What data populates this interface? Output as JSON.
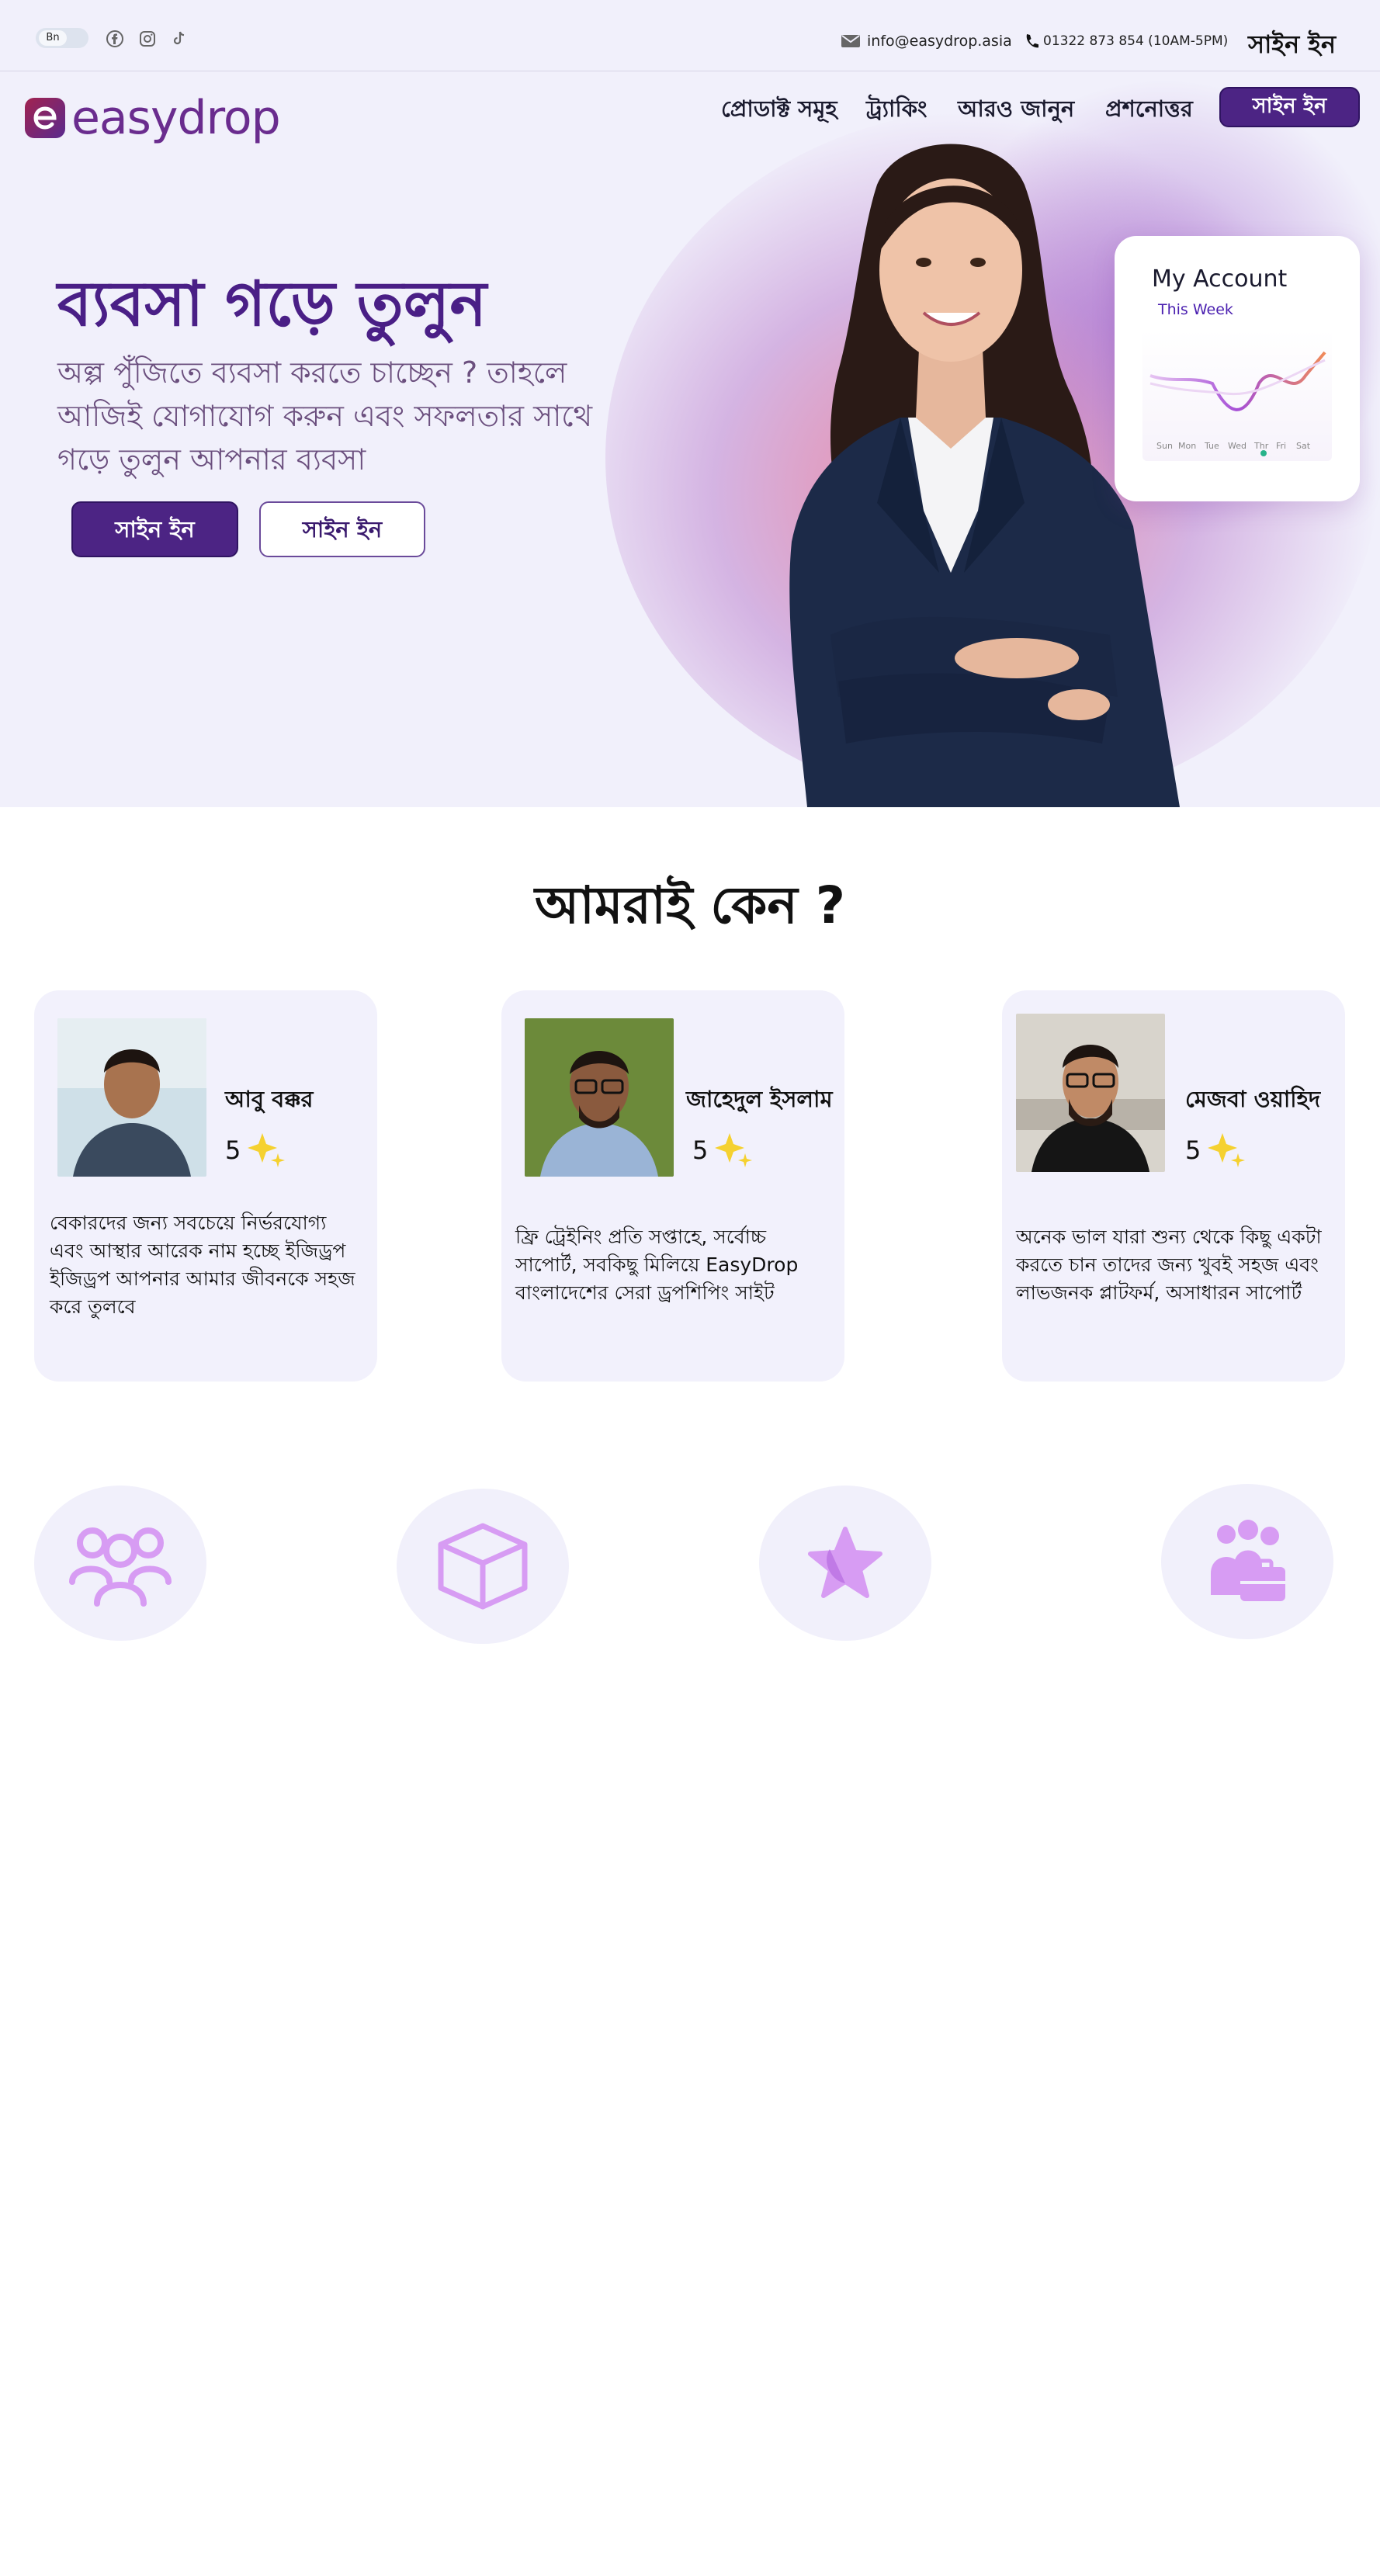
{
  "topbar": {
    "lang_label": "Bn",
    "email": "info@easydrop.asia",
    "phone": "01322 873 854 (10AM-5PM)",
    "signin": "সাইন ইন"
  },
  "logo": {
    "text": "easydrop"
  },
  "nav": {
    "items": [
      "প্রোডাক্ট সমূহ",
      "ট্র্যাকিং",
      "আরও জানুন",
      "প্রশনোত্তর"
    ],
    "button": "সাইন ইন"
  },
  "hero": {
    "title": "ব্যবসা গড়ে তুলুন",
    "subtitle": "অল্প পুঁজিতে ব্যবসা করতে চাচ্ছেন ? তাহলে আজিই যোগাযোগ করুন এবং সফলতার সাথে গড়ে তুলুন আপনার ব্যবসা",
    "button_primary": "সাইন ইন",
    "button_secondary": "সাইন ইন"
  },
  "account_card": {
    "title": "My Account",
    "period": "This Week",
    "days": [
      "Sun",
      "Mon",
      "Tue",
      "Wed",
      "Thr",
      "Fri",
      "Sat"
    ]
  },
  "why": {
    "title": "আমরাই কেন ?",
    "cards": [
      {
        "name": "আবু বক্কর",
        "rating": "5",
        "text": "বেকারদের জন্য সবচেয়ে নির্ভরযোগ্য এবং আস্থার আরেক নাম হচ্ছে ইজিড্রপ ইজিড্রপ আপনার আমার জীবনকে সহজ করে তুলবে"
      },
      {
        "name": "জাহেদুল ইসলাম",
        "rating": "5",
        "text": "ফ্রি ট্রেইনিং প্রতি সপ্তাহে, সর্বোচ্চ সাপোর্ট, সবকিছু মিলিয়ে EasyDrop বাংলাদেশের সেরা ড্রপশিপিং সাইট"
      },
      {
        "name": "মেজবা ওয়াহিদ",
        "rating": "5",
        "text": "অনেক ভাল যারা শুন্য থেকে কিছু একটা করতে চান তাদের জন্য খুবই সহজ এবং লাভজনক প্লাটফর্ম, অসাধারন সাপোর্ট"
      }
    ]
  },
  "features": {
    "icons": [
      "users-icon",
      "box-icon",
      "star-icon",
      "team-briefcase-icon"
    ]
  },
  "colors": {
    "brand_purple": "#4c2484",
    "hero_bg": "#f1f0fb",
    "card_bg": "#f2f1fc",
    "icon_purple": "#d79cf3"
  }
}
